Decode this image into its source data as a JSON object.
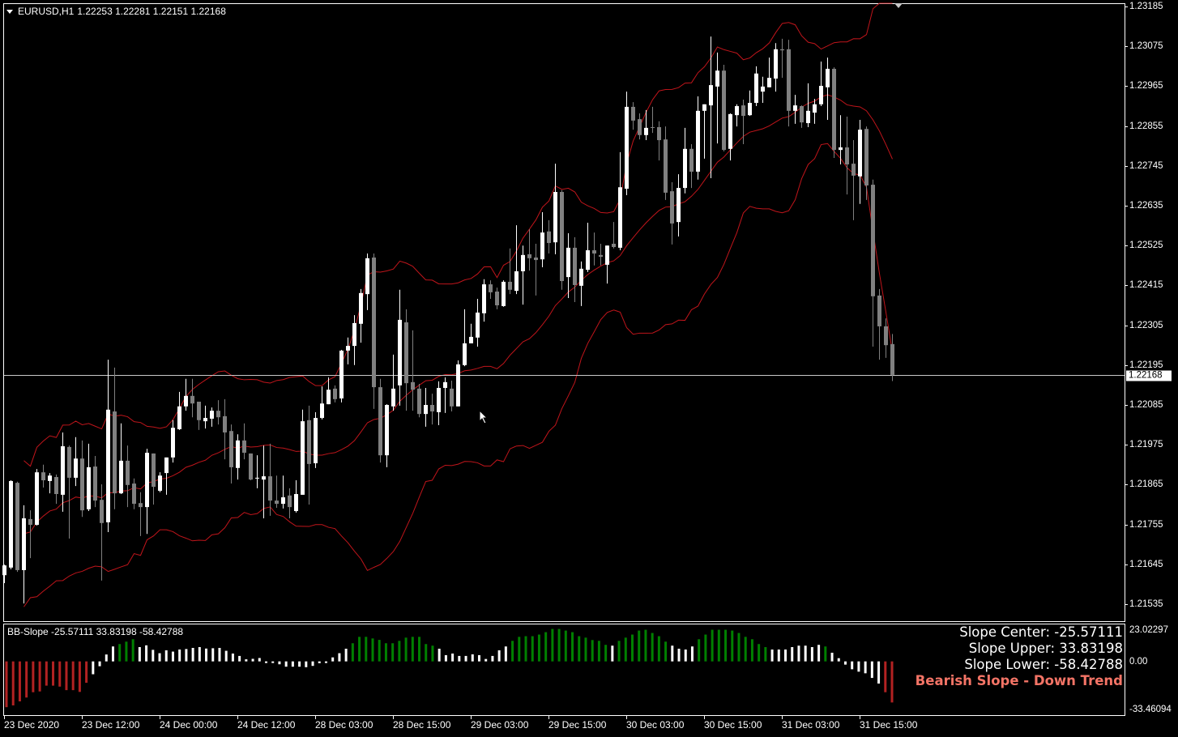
{
  "header": {
    "symbol": "EURUSD,H1",
    "ohlc_text": "1.22253 1.22281 1.22151 1.22168"
  },
  "indicator": {
    "title": "BB-Slope -25.57111 33.83198 -58.42788",
    "slope_center": "Slope Center: -25.57111",
    "slope_upper": "Slope Upper: 33.83198",
    "slope_lower": "Slope Lower: -58.42788",
    "trend_text": "Bearish Slope - Down Trend",
    "axis_labels": [
      "23.02297",
      "0.00",
      "-33.46094"
    ]
  },
  "colors": {
    "background": "#000000",
    "bull_candle": "#ffffff",
    "bear_candle": "#808080",
    "bands": "#c0151b",
    "hist_up": "#008000",
    "hist_flat": "#ffffff",
    "hist_down": "#b22222",
    "trend_text": "#f47466"
  },
  "chart_data": [
    {
      "type": "candlestick",
      "title": "EURUSD,H1",
      "ylim": [
        1.21488,
        1.23194
      ],
      "price_ticks": [
        "1.23185",
        "1.23075",
        "1.22965",
        "1.22855",
        "1.22745",
        "1.22635",
        "1.22525",
        "1.22415",
        "1.22305",
        "1.22195",
        "1.22085",
        "1.21975",
        "1.21865",
        "1.21755",
        "1.21645",
        "1.21535"
      ],
      "current_price": "1.22168",
      "time_labels": [
        {
          "bar": 0,
          "label": "23 Dec 2020"
        },
        {
          "bar": 12,
          "label": "23 Dec 12:00"
        },
        {
          "bar": 24,
          "label": "24 Dec 00:00"
        },
        {
          "bar": 36,
          "label": "24 Dec 12:00"
        },
        {
          "bar": 48,
          "label": "28 Dec 03:00"
        },
        {
          "bar": 60,
          "label": "28 Dec 15:00"
        },
        {
          "bar": 72,
          "label": "29 Dec 03:00"
        },
        {
          "bar": 84,
          "label": "29 Dec 15:00"
        },
        {
          "bar": 96,
          "label": "30 Dec 03:00"
        },
        {
          "bar": 108,
          "label": "30 Dec 15:00"
        },
        {
          "bar": 120,
          "label": "31 Dec 03:00"
        },
        {
          "bar": 132,
          "label": "31 Dec 15:00"
        }
      ],
      "bollinger": {
        "period": 20,
        "deviation": 2
      },
      "ohlc": [
        [
          1.21615,
          1.21644,
          1.21593,
          1.21642
        ],
        [
          1.21636,
          1.21877,
          1.21631,
          1.21875
        ],
        [
          1.2187,
          1.21873,
          1.21624,
          1.21629
        ],
        [
          1.21629,
          1.21808,
          1.21537,
          1.21772
        ],
        [
          1.2177,
          1.21794,
          1.21662,
          1.21754
        ],
        [
          1.21754,
          1.21908,
          1.21752,
          1.21899
        ],
        [
          1.21899,
          1.2192,
          1.21857,
          1.21877
        ],
        [
          1.21875,
          1.21897,
          1.21841,
          1.2189
        ],
        [
          1.21886,
          1.21893,
          1.21812,
          1.21839
        ],
        [
          1.21837,
          1.22009,
          1.2179,
          1.21971
        ],
        [
          1.21969,
          1.21973,
          1.21716,
          1.21884
        ],
        [
          1.21884,
          1.21996,
          1.21861,
          1.21937
        ],
        [
          1.21937,
          1.21987,
          1.21776,
          1.21794
        ],
        [
          1.21797,
          1.21978,
          1.21792,
          1.21913
        ],
        [
          1.21915,
          1.21944,
          1.21803,
          1.21821
        ],
        [
          1.21823,
          1.21866,
          1.216,
          1.21759
        ],
        [
          1.21761,
          1.2221,
          1.21734,
          1.22072
        ],
        [
          1.22067,
          1.22188,
          1.21797,
          1.21841
        ],
        [
          1.21841,
          1.22034,
          1.21839,
          1.21931
        ],
        [
          1.21931,
          1.21973,
          1.21803,
          1.21864
        ],
        [
          1.21868,
          1.21882,
          1.21797,
          1.21812
        ],
        [
          1.21814,
          1.21844,
          1.21723,
          1.21803
        ],
        [
          1.21803,
          1.21964,
          1.21729,
          1.21953
        ],
        [
          1.21951,
          1.21951,
          1.2181,
          1.21859
        ],
        [
          1.21848,
          1.21899,
          1.21844,
          1.2189
        ],
        [
          1.21897,
          1.2194,
          1.21837,
          1.2194
        ],
        [
          1.2194,
          1.22043,
          1.21926,
          1.22022
        ],
        [
          1.22018,
          1.22121,
          1.22016,
          1.22081
        ],
        [
          1.22081,
          1.22157,
          1.22069,
          1.2211
        ],
        [
          1.2211,
          1.22157,
          1.22051,
          1.22089
        ],
        [
          1.22094,
          1.22094,
          1.22016,
          1.22043
        ],
        [
          1.2204,
          1.22083,
          1.2202,
          1.22049
        ],
        [
          1.22047,
          1.22078,
          1.22025,
          1.22069
        ],
        [
          1.22069,
          1.22098,
          1.22031,
          1.22051
        ],
        [
          1.22054,
          1.22101,
          1.21935,
          1.22009
        ],
        [
          1.22013,
          1.22031,
          1.21868,
          1.21913
        ],
        [
          1.21911,
          1.22004,
          1.21879,
          1.21987
        ],
        [
          1.21987,
          1.22034,
          1.21935,
          1.21953
        ],
        [
          1.21951,
          1.21951,
          1.21877,
          1.21879
        ],
        [
          1.21882,
          1.21946,
          1.21855,
          1.21884
        ],
        [
          1.21879,
          1.21973,
          1.21772,
          1.21888
        ],
        [
          1.21888,
          1.21978,
          1.21779,
          1.21821
        ],
        [
          1.21821,
          1.2189,
          1.21801,
          1.21812
        ],
        [
          1.21812,
          1.2189,
          1.21799,
          1.2183
        ],
        [
          1.21835,
          1.21855,
          1.21772,
          1.21803
        ],
        [
          1.21792,
          1.21877,
          1.21788,
          1.21839
        ],
        [
          1.21837,
          1.22072,
          1.21837,
          1.2204
        ],
        [
          1.22043,
          1.22083,
          1.2181,
          1.21922
        ],
        [
          1.21924,
          1.22065,
          1.21911,
          1.22049
        ],
        [
          1.22049,
          1.22136,
          1.22045,
          1.22089
        ],
        [
          1.22087,
          1.22161,
          1.22087,
          1.22127
        ],
        [
          1.2213,
          1.22139,
          1.22092,
          1.22101
        ],
        [
          1.22103,
          1.22237,
          1.22092,
          1.22235
        ],
        [
          1.22235,
          1.22271,
          1.22197,
          1.22248
        ],
        [
          1.22248,
          1.22333,
          1.22195,
          1.22311
        ],
        [
          1.22309,
          1.22405,
          1.22257,
          1.22394
        ],
        [
          1.22391,
          1.22503,
          1.22347,
          1.2249
        ],
        [
          1.22492,
          1.22503,
          1.22074,
          1.22134
        ],
        [
          1.22134,
          1.22157,
          1.21926,
          1.21946
        ],
        [
          1.21946,
          1.22087,
          1.21913,
          1.22085
        ],
        [
          1.22081,
          1.22224,
          1.22069,
          1.2213
        ],
        [
          1.22139,
          1.22403,
          1.22083,
          1.2232
        ],
        [
          1.22313,
          1.22349,
          1.22069,
          1.22145
        ],
        [
          1.22148,
          1.22291,
          1.22069,
          1.22127
        ],
        [
          1.2213,
          1.22143,
          1.22051,
          1.2206
        ],
        [
          1.2206,
          1.22132,
          1.22025,
          1.22085
        ],
        [
          1.22085,
          1.22116,
          1.22031,
          1.22067
        ],
        [
          1.22065,
          1.2215,
          1.22029,
          1.22132
        ],
        [
          1.22132,
          1.22161,
          1.22063,
          1.22148
        ],
        [
          1.2213,
          1.22152,
          1.22067,
          1.22081
        ],
        [
          1.22081,
          1.22208,
          1.22081,
          1.22197
        ],
        [
          1.22195,
          1.22349,
          1.22192,
          1.22255
        ],
        [
          1.22255,
          1.22309,
          1.22255,
          1.22273
        ],
        [
          1.22271,
          1.22378,
          1.22246,
          1.2234
        ],
        [
          1.22338,
          1.22432,
          1.22315,
          1.22418
        ],
        [
          1.22418,
          1.22429,
          1.22378,
          1.22396
        ],
        [
          1.22398,
          1.22409,
          1.22349,
          1.2236
        ],
        [
          1.22358,
          1.22429,
          1.22356,
          1.22425
        ],
        [
          1.22425,
          1.22517,
          1.22391,
          1.22403
        ],
        [
          1.224,
          1.22581,
          1.22391,
          1.22454
        ],
        [
          1.22454,
          1.22525,
          1.22362,
          1.22499
        ],
        [
          1.22501,
          1.2257,
          1.22456,
          1.2249
        ],
        [
          1.22492,
          1.2253,
          1.22387,
          1.22485
        ],
        [
          1.22487,
          1.22617,
          1.22465,
          1.22561
        ],
        [
          1.22564,
          1.22595,
          1.22503,
          1.22532
        ],
        [
          1.22534,
          1.22751,
          1.22501,
          1.22673
        ],
        [
          1.22673,
          1.22678,
          1.22403,
          1.22427
        ],
        [
          1.22438,
          1.22559,
          1.2238,
          1.22519
        ],
        [
          1.22519,
          1.22548,
          1.22369,
          1.22416
        ],
        [
          1.22414,
          1.22481,
          1.22358,
          1.22461
        ],
        [
          1.22458,
          1.22588,
          1.22452,
          1.22512
        ],
        [
          1.22512,
          1.22561,
          1.2247,
          1.22503
        ],
        [
          1.22499,
          1.2253,
          1.2247,
          1.22494
        ],
        [
          1.22472,
          1.22525,
          1.2242,
          1.22525
        ],
        [
          1.2253,
          1.2259,
          1.22517,
          1.22521
        ],
        [
          1.22519,
          1.22783,
          1.22512,
          1.22686
        ],
        [
          1.22682,
          1.2295,
          1.22664,
          1.22908
        ],
        [
          1.22908,
          1.22921,
          1.22845,
          1.2287
        ],
        [
          1.22874,
          1.2289,
          1.22818,
          1.2283
        ],
        [
          1.2283,
          1.22899,
          1.22816,
          1.2285
        ],
        [
          1.22852,
          1.22908,
          1.22836,
          1.2285
        ],
        [
          1.22852,
          1.22868,
          1.2276,
          1.22816
        ],
        [
          1.22818,
          1.22854,
          1.22651,
          1.22671
        ],
        [
          1.22675,
          1.227,
          1.22528,
          1.22586
        ],
        [
          1.2259,
          1.22722,
          1.2255,
          1.22684
        ],
        [
          1.22684,
          1.2285,
          1.22669,
          1.22792
        ],
        [
          1.22792,
          1.22805,
          1.22684,
          1.22729
        ],
        [
          1.22729,
          1.22937,
          1.22707,
          1.22897
        ],
        [
          1.22897,
          1.22915,
          1.22765,
          1.22915
        ],
        [
          1.22912,
          1.23102,
          1.22711,
          1.22968
        ],
        [
          1.22964,
          1.23058,
          1.22807,
          1.23008
        ],
        [
          1.23008,
          1.23024,
          1.22785,
          1.22789
        ],
        [
          1.22792,
          1.2289,
          1.2276,
          1.22888
        ],
        [
          1.22885,
          1.22915,
          1.22854,
          1.2291
        ],
        [
          1.22912,
          1.22928,
          1.22805,
          1.22883
        ],
        [
          1.22885,
          1.22953,
          1.22883,
          1.22919
        ],
        [
          1.22919,
          1.2302,
          1.2291,
          1.23
        ],
        [
          1.2295,
          1.22991,
          1.22919,
          1.22964
        ],
        [
          1.22962,
          1.23044,
          1.22962,
          1.22988
        ],
        [
          1.22986,
          1.23084,
          1.2295,
          1.23067
        ],
        [
          1.23067,
          1.23096,
          1.22988,
          1.23064
        ],
        [
          1.23067,
          1.23093,
          1.22854,
          1.22897
        ],
        [
          1.22897,
          1.22941,
          1.22861,
          1.22912
        ],
        [
          1.2291,
          1.22912,
          1.2285,
          1.22865
        ],
        [
          1.22863,
          1.22973,
          1.22852,
          1.22897
        ],
        [
          1.22892,
          1.2293,
          1.22861,
          1.22915
        ],
        [
          1.22915,
          1.23033,
          1.2291,
          1.22966
        ],
        [
          1.22962,
          1.23044,
          1.22872,
          1.23013
        ],
        [
          1.23013,
          1.23017,
          1.22767,
          1.22789
        ],
        [
          1.22789,
          1.22885,
          1.22749,
          1.22796
        ],
        [
          1.22796,
          1.22881,
          1.22666,
          1.22749
        ],
        [
          1.22751,
          1.22816,
          1.22595,
          1.22718
        ],
        [
          1.22716,
          1.22872,
          1.2264,
          1.22845
        ],
        [
          1.22847,
          1.22854,
          1.22651,
          1.22691
        ],
        [
          1.22693,
          1.22707,
          1.22246,
          1.22385
        ],
        [
          1.22387,
          1.22405,
          1.2221,
          1.22302
        ],
        [
          1.22302,
          1.22324,
          1.22215,
          1.2225
        ],
        [
          1.22253,
          1.22281,
          1.22151,
          1.22168
        ]
      ]
    },
    {
      "type": "bar",
      "title": "BB-Slope",
      "ylim": [
        -33.46094,
        23.02297
      ],
      "values": [
        -28.5,
        -27.4,
        -24.9,
        -22.5,
        -19.2,
        -18.7,
        -15.1,
        -15.1,
        -15.7,
        -17.9,
        -17.9,
        -19.0,
        -13.3,
        -8.0,
        -3.0,
        4.3,
        9.3,
        10.8,
        12.3,
        13.8,
        8.9,
        10.0,
        7.2,
        5.1,
        6.9,
        6.1,
        7.4,
        7.7,
        8.4,
        8.9,
        8.0,
        8.2,
        8.4,
        6.6,
        4.9,
        3.4,
        1.3,
        1.6,
        2.1,
        -1.0,
        -1.0,
        -1.8,
        -3.3,
        -3.3,
        -3.3,
        -3.6,
        -2.8,
        -1.1,
        -1.0,
        2.5,
        5.1,
        7.9,
        11.3,
        15.3,
        15.3,
        14.3,
        13.4,
        11.3,
        11.3,
        12.8,
        14.8,
        15.3,
        15.3,
        10.8,
        9.8,
        7.9,
        3.9,
        4.9,
        3.4,
        3.4,
        4.4,
        3.9,
        1.5,
        3.4,
        6.9,
        9.3,
        12.8,
        15.3,
        15.7,
        15.7,
        16.7,
        18.2,
        20.2,
        20.2,
        19.2,
        18.2,
        15.7,
        14.8,
        13.3,
        12.8,
        10.3,
        9.8,
        12.8,
        14.8,
        16.7,
        19.2,
        19.7,
        17.7,
        15.7,
        12.3,
        9.8,
        7.9,
        7.4,
        9.3,
        13.8,
        16.7,
        19.7,
        19.7,
        19.7,
        19.2,
        17.7,
        15.3,
        13.8,
        10.8,
        8.9,
        7.4,
        7.4,
        7.4,
        8.9,
        9.8,
        9.8,
        8.9,
        10.3,
        9.3,
        5.4,
        2.0,
        -2.0,
        -4.9,
        -6.4,
        -7.4,
        -10.3,
        -13.8,
        -19.2,
        -25.57
      ],
      "states": "rrrrrrrrrrrrrwwwwgggwwwwwwwwwwwwwwwwwwwwwwwwwwwwwwwwgggggggggggggwwwwwwwwwwwgggggggggggggggwggggggggwwwwgggggggggggwwwwwwwwgwwwwwwwwrrrr"
    }
  ]
}
